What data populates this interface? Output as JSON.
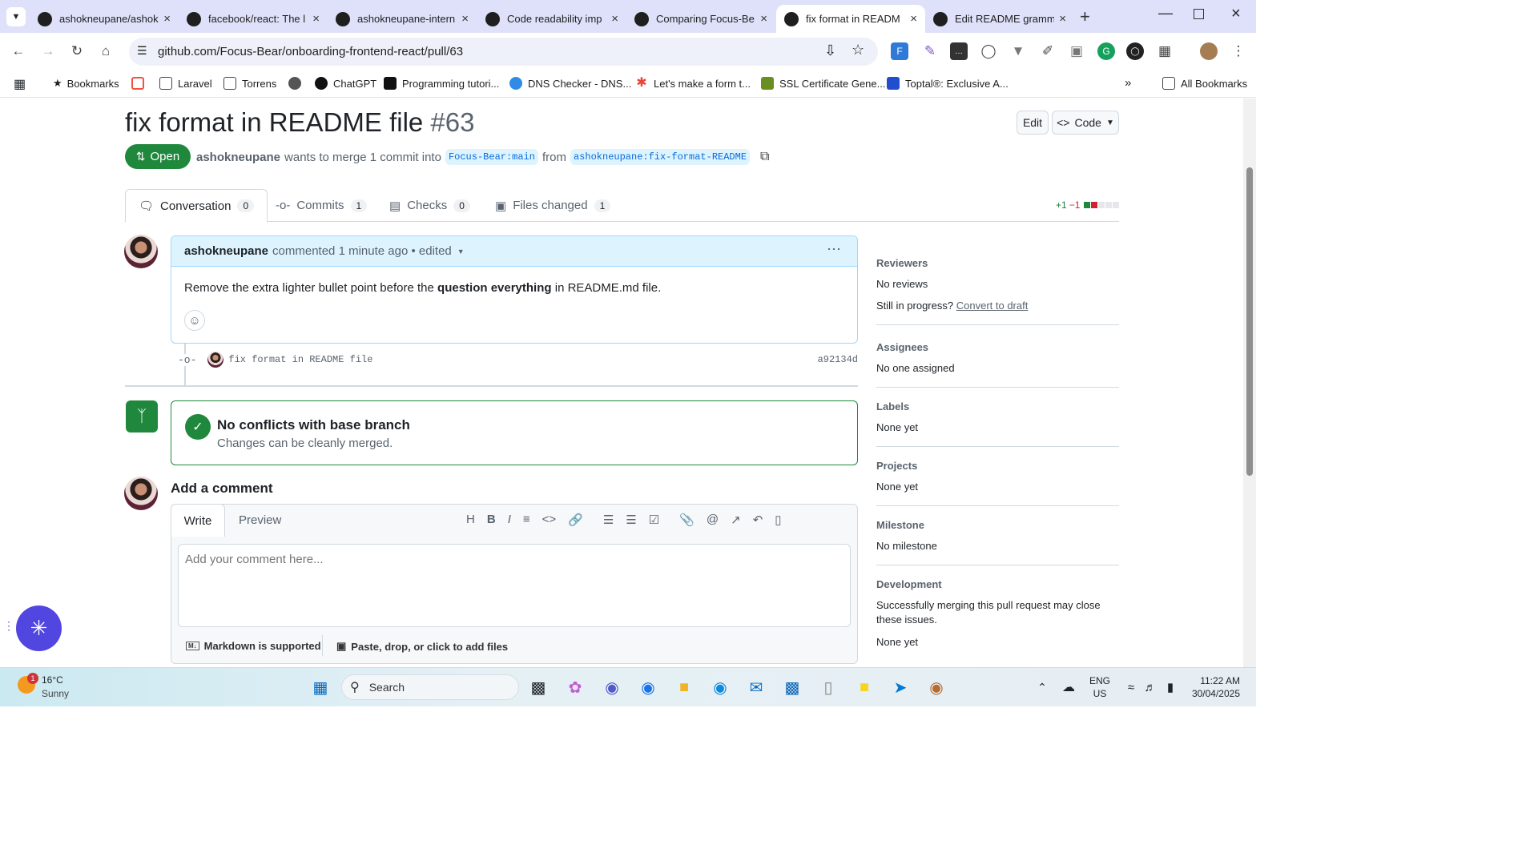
{
  "browser": {
    "tabs": [
      {
        "title": "ashokneupane/ashok",
        "icon": "github-icon",
        "active": false
      },
      {
        "title": "facebook/react: The l",
        "icon": "github-icon",
        "active": false
      },
      {
        "title": "ashokneupane-intern",
        "icon": "github-icon",
        "active": false
      },
      {
        "title": "Code readability imp",
        "icon": "chatgpt-icon",
        "active": false
      },
      {
        "title": "Comparing Focus-Be",
        "icon": "github-icon",
        "active": false
      },
      {
        "title": "fix format in READM",
        "icon": "github-icon",
        "active": true
      },
      {
        "title": "Edit README gramm",
        "icon": "chatgpt-icon",
        "active": false
      }
    ],
    "url": "github.com/Focus-Bear/onboarding-frontend-react/pull/63",
    "bookmarks": [
      "Bookmarks",
      "Laravel",
      "Torrens",
      "ChatGPT",
      "Programming tutori...",
      "DNS Checker - DNS...",
      "Let's make a form t...",
      "SSL Certificate Gene...",
      "Toptal®: Exclusive A..."
    ],
    "all_bookmarks": "All Bookmarks",
    "colors": {
      "tabbar": "#dee1f9",
      "omnibox": "#eef1f9"
    }
  },
  "pr": {
    "title": "fix format in README file",
    "number": "#63",
    "edit_label": "Edit",
    "code_label": "Code",
    "state": "Open",
    "author": "ashokneupane",
    "meta_text": "wants to merge 1 commit into",
    "base_branch": "Focus-Bear:main",
    "from_text": "from",
    "head_branch": "ashokneupane:fix-format-README",
    "tabs": [
      {
        "label": "Conversation",
        "count": "0"
      },
      {
        "label": "Commits",
        "count": "1"
      },
      {
        "label": "Checks",
        "count": "0"
      },
      {
        "label": "Files changed",
        "count": "1"
      }
    ],
    "diffstat_add": "+1",
    "diffstat_del": "−1"
  },
  "comment": {
    "author": "ashokneupane",
    "meta": "commented 1 minute ago • edited",
    "body_before": "Remove the extra lighter bullet point before the",
    "body_bold": "question everything",
    "body_after": "in README.md file."
  },
  "commit": {
    "message": "fix format in README file",
    "sha": "a92134d"
  },
  "merge": {
    "title": "No conflicts with base branch",
    "subtitle": "Changes can be cleanly merged."
  },
  "composer": {
    "heading": "Add a comment",
    "tab_write": "Write",
    "tab_preview": "Preview",
    "placeholder": "Add your comment here...",
    "markdown_note": "Markdown is supported",
    "attach_note": "Paste, drop, or click to add files"
  },
  "sidebar": {
    "reviewers_h": "Reviewers",
    "reviewers_v": "No reviews",
    "progress_text": "Still in progress?",
    "draft_link": "Convert to draft",
    "assignees_h": "Assignees",
    "assignees_v": "No one assigned",
    "labels_h": "Labels",
    "labels_v": "None yet",
    "projects_h": "Projects",
    "projects_v": "None yet",
    "milestone_h": "Milestone",
    "milestone_v": "No milestone",
    "development_h": "Development",
    "development_v": "Successfully merging this pull request may close these issues.",
    "development_v2": "None yet"
  },
  "taskbar": {
    "weather_temp": "16°C",
    "weather_desc": "Sunny",
    "weather_badge": "1",
    "search": "Search",
    "lang1": "ENG",
    "lang2": "US",
    "time": "11:22 AM",
    "date": "30/04/2025"
  }
}
